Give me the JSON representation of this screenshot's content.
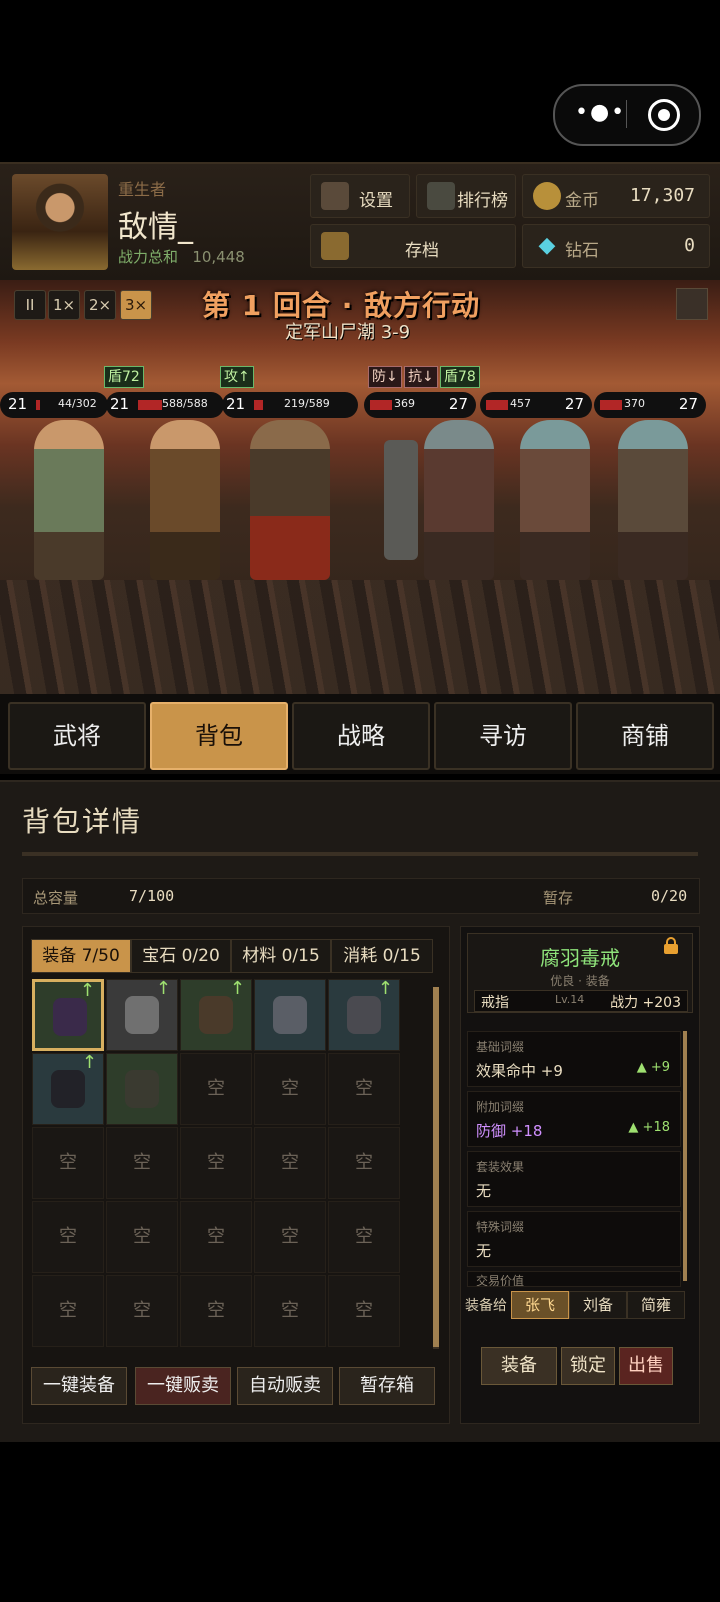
{
  "header": {
    "player_subtitle": "重生者",
    "player_name": "敌情_",
    "power_label": "战力总和",
    "power_value": "10,448",
    "settings_label": "设置",
    "ranking_label": "排行榜",
    "gold_label": "金币",
    "gold_value": "17,307",
    "save_label": "存档",
    "diamond_label": "钻石",
    "diamond_value": "0"
  },
  "battle": {
    "speeds": [
      "II",
      "1×",
      "2×",
      "3×"
    ],
    "round_title": "第 1 回合 · 敌方行动",
    "stage": "定军山尸潮 3-9",
    "units": [
      {
        "level": "21",
        "hp": "44/302"
      },
      {
        "level": "21",
        "hp": "588/588"
      },
      {
        "level": "21",
        "hp": "219/589"
      },
      {
        "level": "27",
        "hp": "369"
      },
      {
        "level": "27",
        "hp": "457"
      },
      {
        "level": "27",
        "hp": "370"
      }
    ],
    "hp_fractions": [
      0.15,
      1.0,
      0.37,
      0.9,
      0.9,
      0.9
    ],
    "buffs": {
      "shield1": "盾72",
      "attack": "攻↑",
      "def_down": "防↓",
      "res_down": "抗↓",
      "shield2": "盾78"
    }
  },
  "tabs": [
    "武将",
    "背包",
    "战略",
    "寻访",
    "商铺"
  ],
  "bag": {
    "title": "背包详情",
    "capacity_label": "总容量",
    "capacity_value": "7/100",
    "temp_label": "暂存",
    "temp_value": "0/20",
    "categories": [
      "装备 7/50",
      "宝石 0/20",
      "材料 0/15",
      "消耗 0/15"
    ],
    "empty_label": "空",
    "items": [
      "ring",
      "helmet",
      "crossbow",
      "armor",
      "bracer",
      "boots",
      "helmet-red"
    ],
    "upgrade_arrow": "↑",
    "actions": [
      "一键装备",
      "一键贩卖",
      "自动贩卖",
      "暂存箱"
    ]
  },
  "detail": {
    "name": "腐羽毒戒",
    "rarity": "优良 · 装备",
    "slot": "戒指",
    "level": "Lv.14",
    "power": "战力 +203",
    "base_h": "基础词缀",
    "base_v": "效果命中 +9",
    "base_d": "▲ +9",
    "extra_h": "附加词缀",
    "extra_v": "防御 +18",
    "extra_d": "▲ +18",
    "set_h": "套装效果",
    "set_v": "无",
    "special_h": "特殊词缀",
    "special_v": "无",
    "trade_h": "交易价值",
    "equip_to": "装备给",
    "heroes": [
      "张飞",
      "刘备",
      "简雍"
    ],
    "btn_equip": "装备",
    "btn_lock": "锁定",
    "btn_sell": "出售"
  }
}
